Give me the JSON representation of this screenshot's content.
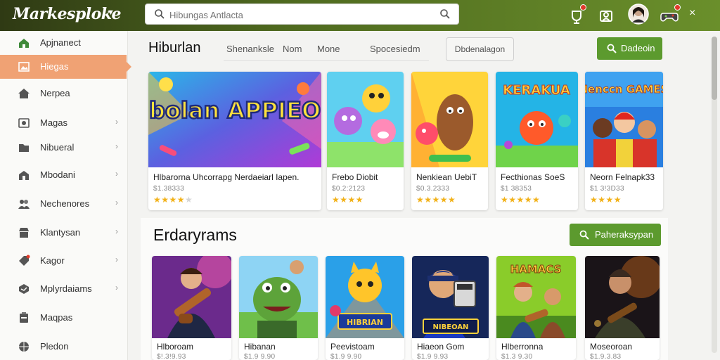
{
  "header": {
    "brand": "Markesploke",
    "search_placeholder": "Hibungas Antlacta",
    "colors": {
      "bar_start": "#2f3a14",
      "bar_end": "#6a8f2b",
      "accent": "#5c9a2e",
      "active_item": "#f0a274",
      "star": "#f2b21a"
    },
    "icons": [
      "search-icon",
      "notification-icon",
      "store-icon",
      "avatar",
      "game-controller-icon"
    ]
  },
  "sidebar": {
    "items": [
      {
        "label": "Apjnanect",
        "icon": "home-icon",
        "chevron": false,
        "active": false
      },
      {
        "label": "Hiegas",
        "icon": "image-icon",
        "chevron": false,
        "active": true
      },
      {
        "label": "Nerpea",
        "icon": "house-icon",
        "chevron": false,
        "active": false
      },
      {
        "label": "Magas",
        "icon": "photo-icon",
        "chevron": true,
        "active": false
      },
      {
        "label": "Nibueral",
        "icon": "folder-icon",
        "chevron": true,
        "active": false
      },
      {
        "label": "Mbodani",
        "icon": "building-icon",
        "chevron": true,
        "active": false
      },
      {
        "label": "Nechenores",
        "icon": "people-icon",
        "chevron": true,
        "active": false
      },
      {
        "label": "Klantysan",
        "icon": "store-icon",
        "chevron": true,
        "active": false
      },
      {
        "label": "Kagor",
        "icon": "tag-icon",
        "chevron": true,
        "active": false
      },
      {
        "label": "Mplyrdaiams",
        "icon": "cube-icon",
        "chevron": true,
        "active": false
      },
      {
        "label": "Maqpas",
        "icon": "clipboard-icon",
        "chevron": false,
        "active": false
      },
      {
        "label": "Pledon",
        "icon": "globe-icon",
        "chevron": false,
        "active": false
      }
    ]
  },
  "section1": {
    "title": "Hiburlan",
    "tabs": [
      "Shenanksle",
      "Nom",
      "Mone",
      "Spocesiedm"
    ],
    "filter_label": "Dbdenalagon",
    "action_label": "Dadeoin",
    "cards": [
      {
        "title": "Hlbarorna Uhcorrapg Nerdaeiarl Iapen.",
        "price": "$1.38333",
        "rating": 4,
        "art": "Hbolan APPIEON",
        "art_theme": "banner"
      },
      {
        "title": "Frebo Diobit",
        "price": "$0.2:2123",
        "rating": 4,
        "art": "",
        "art_theme": "monsters"
      },
      {
        "title": "Nenkiean UebiT",
        "price": "$0.3.2333",
        "rating": 5,
        "art": "",
        "art_theme": "hero"
      },
      {
        "title": "Fecthionas SoeS",
        "price": "$1 38353",
        "rating": 5,
        "art": "KERAKUA",
        "art_theme": "creature"
      },
      {
        "title": "Neorn Felnapk33",
        "price": "$1 3!3D33",
        "rating": 4,
        "art": "Nenccn GAMES",
        "art_theme": "kids"
      }
    ]
  },
  "section2": {
    "title": "Erdaryrams",
    "action_label": "Paheraksypan",
    "cards": [
      {
        "title": "Hlboroam",
        "price": "$!.3!9.93",
        "art": "",
        "art_theme": "guitarist"
      },
      {
        "title": "Hibanan",
        "price": "$1.9 9.90",
        "art": "",
        "art_theme": "ogre"
      },
      {
        "title": "Peevistoam",
        "price": "$1.9 9.90",
        "art": "HIBRIAN",
        "art_theme": "cat"
      },
      {
        "title": "Hiaeon Gom",
        "price": "$1.9 9.93",
        "art": "NIBEOAN",
        "art_theme": "baseball"
      },
      {
        "title": "Hlberronna",
        "price": "$1.3 9.30",
        "art": "HAMACS",
        "art_theme": "musician"
      },
      {
        "title": "Moseoroan",
        "price": "$1.9.3.83",
        "art": "",
        "art_theme": "rocker"
      }
    ]
  }
}
